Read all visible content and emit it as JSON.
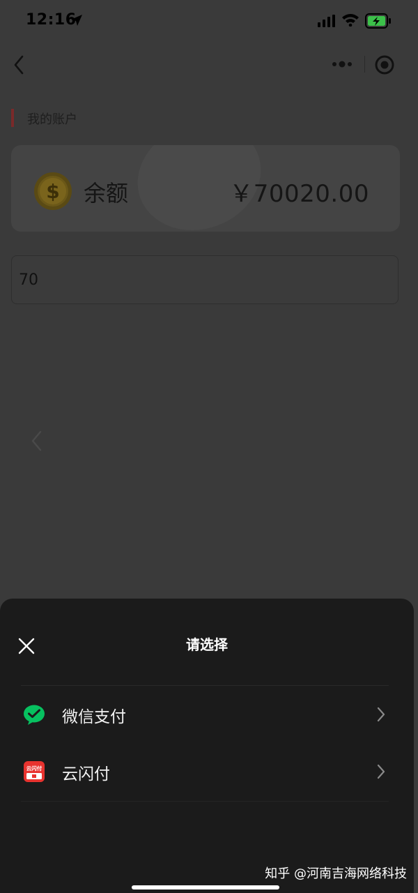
{
  "status_bar": {
    "time": "12:16",
    "icons": [
      "location-arrow-icon",
      "cellular-signal-icon",
      "wifi-icon",
      "battery-charging-icon"
    ],
    "battery_color": "#3cc04a"
  },
  "nav": {
    "icons": [
      "back-chevron-icon",
      "more-dots-icon",
      "target-circle-icon"
    ]
  },
  "account": {
    "section_title": "我的账户",
    "balance_label": "余额",
    "balance_value": "￥70020.00",
    "coin_icon": "dollar-coin-icon",
    "accent_color": "#7a2a2a"
  },
  "amount_input": {
    "value": "70"
  },
  "payment_sheet": {
    "title": "请选择",
    "close_icon": "close-x-icon",
    "options": [
      {
        "label": "微信支付",
        "icon": "wechat-pay-icon",
        "color": "#07c160"
      },
      {
        "label": "云闪付",
        "icon": "unionpay-quickpass-icon",
        "color": "#e8332f",
        "icon_text": "云闪付"
      }
    ]
  },
  "watermark": "知乎 @河南吉海网络科技"
}
